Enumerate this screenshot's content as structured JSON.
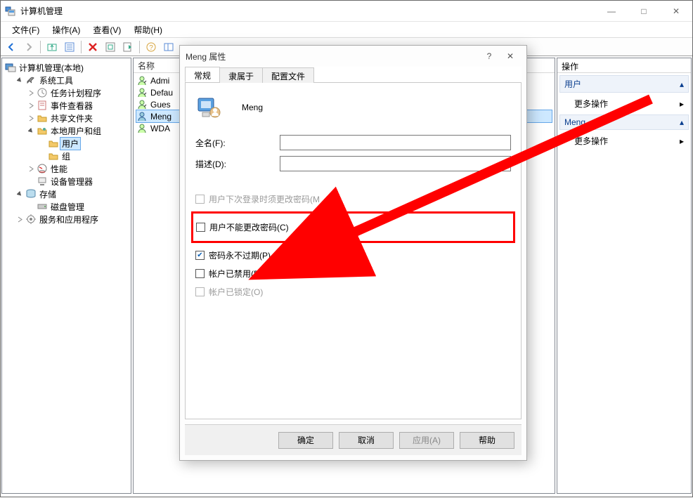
{
  "window": {
    "title": "计算机管理",
    "min": "—",
    "max": "□",
    "close": "✕"
  },
  "menu": {
    "file": "文件(F)",
    "action": "操作(A)",
    "view": "查看(V)",
    "help": "帮助(H)"
  },
  "tree": {
    "root": "计算机管理(本地)",
    "system_tools": "系统工具",
    "task_scheduler": "任务计划程序",
    "event_viewer": "事件查看器",
    "shared_folders": "共享文件夹",
    "local_users": "本地用户和组",
    "users": "用户",
    "groups": "组",
    "performance": "性能",
    "device_manager": "设备管理器",
    "storage": "存储",
    "disk_mgmt": "磁盘管理",
    "services_apps": "服务和应用程序"
  },
  "list": {
    "col_name": "名称",
    "items": [
      "Admi",
      "Defau",
      "Gues",
      "Meng",
      "WDA"
    ]
  },
  "actions": {
    "title": "操作",
    "section1": "用户",
    "more1": "更多操作",
    "section2": "Meng",
    "more2": "更多操作"
  },
  "dialog": {
    "title": "Meng 属性",
    "help": "?",
    "close": "✕",
    "tabs": {
      "general": "常规",
      "memberof": "隶属于",
      "profile": "配置文件"
    },
    "username": "Meng",
    "fullname_label": "全名(F):",
    "fullname_value": "",
    "desc_label": "描述(D):",
    "desc_value": "",
    "chk_mustchange": "用户下次登录时须更改密码(M",
    "chk_cannotchange": "用户不能更改密码(C)",
    "chk_neverexpire": "密码永不过期(P)",
    "chk_disabled": "帐户已禁用(B)",
    "chk_locked": "帐户已锁定(O)",
    "btn_ok": "确定",
    "btn_cancel": "取消",
    "btn_apply": "应用(A)",
    "btn_help": "帮助"
  }
}
